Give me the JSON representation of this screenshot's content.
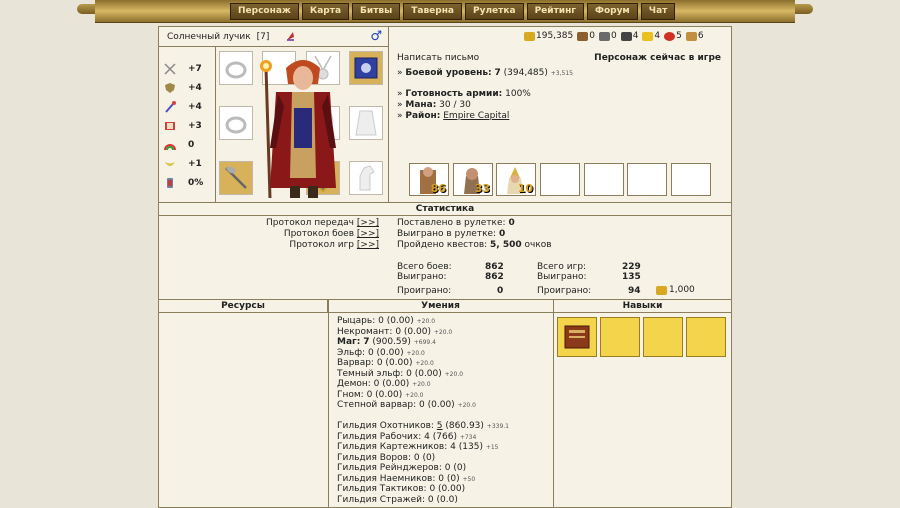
{
  "nav": [
    "Персонаж",
    "Карта",
    "Битвы",
    "Таверна",
    "Рулетка",
    "Рейтинг",
    "Форум",
    "Чат"
  ],
  "character": {
    "name": "Солнечный лучик",
    "level": "[7]",
    "gender": "♂"
  },
  "resources": [
    {
      "icon": "gold-icon",
      "value": "195,385",
      "color": "#d8a820"
    },
    {
      "icon": "wood-icon",
      "value": "0",
      "color": "#8a6030"
    },
    {
      "icon": "ore-icon",
      "value": "0",
      "color": "#6a6a6a"
    },
    {
      "icon": "mercury-icon",
      "value": "4",
      "color": "#444444"
    },
    {
      "icon": "sulfur-icon",
      "value": "4",
      "color": "#e8c020"
    },
    {
      "icon": "crystal-icon",
      "value": "5",
      "color": "#d03020"
    },
    {
      "icon": "gems-icon",
      "value": "6",
      "color": "#c09040"
    }
  ],
  "stats": [
    {
      "icon": "attack-icon",
      "value": "+7"
    },
    {
      "icon": "defense-icon",
      "value": "+4"
    },
    {
      "icon": "spellpower-icon",
      "value": "+4"
    },
    {
      "icon": "knowledge-icon",
      "value": "+3"
    },
    {
      "icon": "luck-icon",
      "value": "0"
    },
    {
      "icon": "morale-icon",
      "value": "+1"
    },
    {
      "icon": "initiative-icon",
      "value": "0%"
    }
  ],
  "info": {
    "write_letter": "Написать письмо",
    "online": "Персонаж сейчас в игре",
    "combat_label": "Боевой уровень:",
    "combat_value": "7",
    "combat_exp": "(394,485)",
    "combat_plus": "+3,515",
    "army_label": "Готовность армии:",
    "army_value": "100%",
    "mana_label": "Мана:",
    "mana_value": "30 / 30",
    "district_label": "Район:",
    "district_value": "Empire Capital"
  },
  "army": [
    {
      "count": "86",
      "color": "#a07040"
    },
    {
      "count": "33",
      "color": "#907050"
    },
    {
      "count": "10",
      "color": "#d8b040"
    },
    {
      "count": ""
    },
    {
      "count": ""
    },
    {
      "count": ""
    },
    {
      "count": ""
    }
  ],
  "statistics": {
    "header": "Статистика",
    "protocols": [
      "Протокол передач",
      "Протокол боев",
      "Протокол игр"
    ],
    "link": "[>>]",
    "roulette_bet_label": "Поставлено в рулетке:",
    "roulette_bet": "0",
    "roulette_won_label": "Выиграно в рулетке:",
    "roulette_won": "0",
    "quests_label": "Пройдено квестов:",
    "quests_value": "5, 500",
    "quests_unit": "очков",
    "battles_total_label": "Всего боев:",
    "battles_total": "862",
    "battles_won_label": "Выиграно:",
    "battles_won": "862",
    "battles_lost_label": "Проиграно:",
    "battles_lost": "0",
    "games_total_label": "Всего игр:",
    "games_total": "229",
    "games_won_label": "Выиграно:",
    "games_won": "135",
    "games_lost_label": "Проиграно:",
    "games_lost": "94",
    "games_gold": "1,000"
  },
  "sections": {
    "resources": "Ресурсы",
    "skills": "Умения",
    "talents": "Навыки"
  },
  "skills": [
    {
      "label": "Рыцарь:",
      "value": "0 (0.00)",
      "plus": "+20.0"
    },
    {
      "label": "Некромант:",
      "value": "0 (0.00)",
      "plus": "+20.0"
    },
    {
      "label": "Маг:",
      "value": "7",
      "extra": "(900.59)",
      "plus": "+699.4",
      "bold": true
    },
    {
      "label": "Эльф:",
      "value": "0 (0.00)",
      "plus": "+20.0"
    },
    {
      "label": "Варвар:",
      "value": "0 (0.00)",
      "plus": "+20.0"
    },
    {
      "label": "Темный эльф:",
      "value": "0 (0.00)",
      "plus": "+20.0"
    },
    {
      "label": "Демон:",
      "value": "0 (0.00)",
      "plus": "+20.0"
    },
    {
      "label": "Гном:",
      "value": "0 (0.00)",
      "plus": "+20.0"
    },
    {
      "label": "Степной варвар:",
      "value": "0 (0.00)",
      "plus": "+20.0"
    },
    {
      "label": "",
      "value": "",
      "plus": ""
    },
    {
      "label": "Гильдия Охотников:",
      "value": "5",
      "extra": "(860.93)",
      "plus": "+339.1",
      "under": true
    },
    {
      "label": "Гильдия Рабочих:",
      "value": "4",
      "extra": "(766)",
      "plus": "+734"
    },
    {
      "label": "Гильдия Картежников:",
      "value": "4",
      "extra": "(135)",
      "plus": "+15"
    },
    {
      "label": "Гильдия Воров:",
      "value": "0 (0)",
      "plus": ""
    },
    {
      "label": "Гильдия Рейнджеров:",
      "value": "0 (0)",
      "plus": ""
    },
    {
      "label": "Гильдия Наемников:",
      "value": "0 (0)",
      "plus": "+50"
    },
    {
      "label": "Гильдия Тактиков:",
      "value": "0 (0.00)",
      "plus": ""
    },
    {
      "label": "Гильдия Стражей:",
      "value": "0 (0.0)",
      "plus": ""
    }
  ]
}
